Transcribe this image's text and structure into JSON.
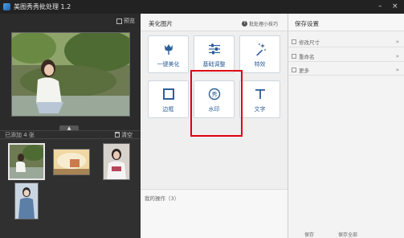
{
  "app": {
    "title": "美图秀秀批处理 1.2"
  },
  "left": {
    "preview_label": "预览",
    "count_label": "已添加 4 张",
    "clear_label": "清空"
  },
  "middle": {
    "title": "美化图片",
    "tips_label": "批处理小技巧",
    "tools": [
      {
        "label": "一键美化"
      },
      {
        "label": "基础调整"
      },
      {
        "label": "特效"
      },
      {
        "label": "边框"
      },
      {
        "label": "水印"
      },
      {
        "label": "文字"
      }
    ],
    "history_label": "我的操作（3）"
  },
  "right": {
    "title": "保存设置",
    "rows": [
      {
        "label": "修改尺寸"
      },
      {
        "label": "重命名"
      },
      {
        "label": "更多"
      }
    ],
    "bottom": [
      "保存",
      "保存全部"
    ]
  },
  "colors": {
    "highlight": "#e00010",
    "tool_label": "#2d5f98",
    "tool_icon": "#2d5f98"
  }
}
